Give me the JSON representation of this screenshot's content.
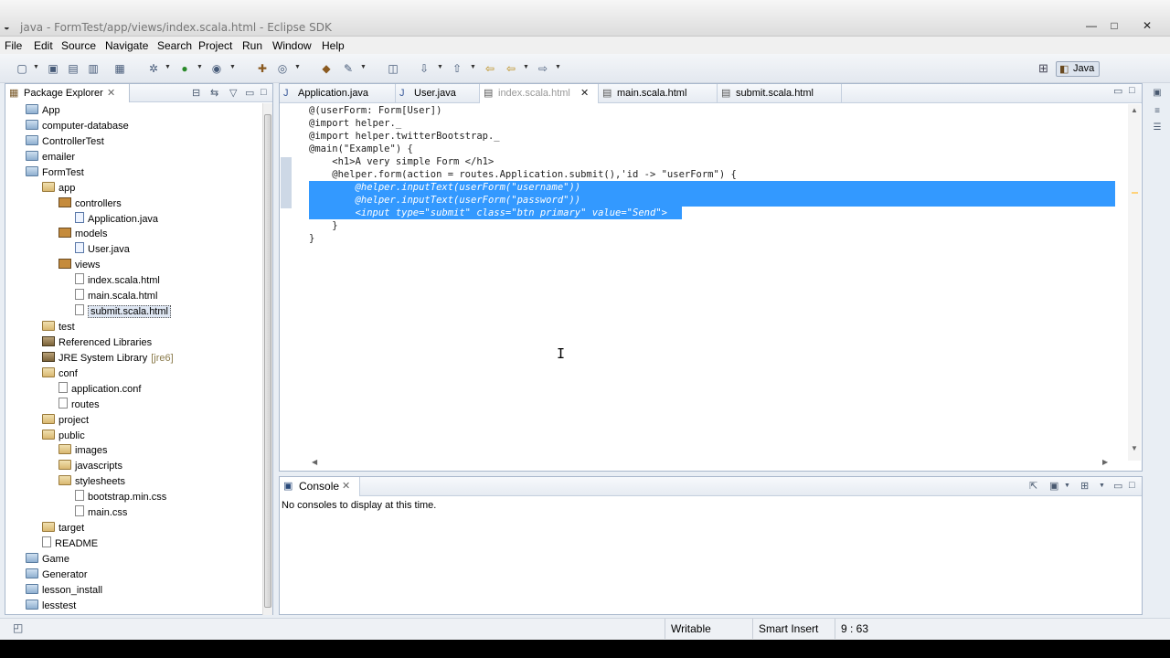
{
  "window": {
    "title": "java - FormTest/app/views/index.scala.html - Eclipse SDK",
    "minimize": "—",
    "maximize": "□",
    "close": "✕"
  },
  "menu": [
    "File",
    "Edit",
    "Source",
    "Navigate",
    "Search",
    "Project",
    "Run",
    "Window",
    "Help"
  ],
  "perspective": {
    "label": "Java"
  },
  "package_explorer": {
    "title": "Package Explorer",
    "items": [
      {
        "label": "App",
        "icon": "folder-icon",
        "depth": 0
      },
      {
        "label": "computer-database",
        "icon": "folder-icon",
        "depth": 0
      },
      {
        "label": "ControllerTest",
        "icon": "folder-icon",
        "depth": 0
      },
      {
        "label": "emailer",
        "icon": "folder-icon",
        "depth": 0
      },
      {
        "label": "FormTest",
        "icon": "folder-icon",
        "depth": 0
      },
      {
        "label": "app",
        "icon": "open-folder-icon",
        "depth": 1
      },
      {
        "label": "controllers",
        "icon": "package-icon",
        "depth": 2
      },
      {
        "label": "Application.java",
        "icon": "java-file-icon",
        "depth": 3
      },
      {
        "label": "models",
        "icon": "package-icon",
        "depth": 2
      },
      {
        "label": "User.java",
        "icon": "java-file-icon",
        "depth": 3
      },
      {
        "label": "views",
        "icon": "package-icon",
        "depth": 2
      },
      {
        "label": "index.scala.html",
        "icon": "file-icon",
        "depth": 3
      },
      {
        "label": "main.scala.html",
        "icon": "file-icon",
        "depth": 3
      },
      {
        "label": "submit.scala.html",
        "icon": "file-icon",
        "depth": 3,
        "selected": true
      },
      {
        "label": "test",
        "icon": "open-folder-icon",
        "depth": 1
      },
      {
        "label": "Referenced Libraries",
        "icon": "library-icon",
        "depth": 1
      },
      {
        "label": "JRE System Library",
        "suffix": "[jre6]",
        "icon": "library-icon",
        "depth": 1
      },
      {
        "label": "conf",
        "icon": "open-folder-icon",
        "depth": 1
      },
      {
        "label": "application.conf",
        "icon": "file-icon",
        "depth": 2
      },
      {
        "label": "routes",
        "icon": "file-icon",
        "depth": 2
      },
      {
        "label": "project",
        "icon": "open-folder-icon",
        "depth": 1
      },
      {
        "label": "public",
        "icon": "open-folder-icon",
        "depth": 1
      },
      {
        "label": "images",
        "icon": "open-folder-icon",
        "depth": 2
      },
      {
        "label": "javascripts",
        "icon": "open-folder-icon",
        "depth": 2
      },
      {
        "label": "stylesheets",
        "icon": "open-folder-icon",
        "depth": 2
      },
      {
        "label": "bootstrap.min.css",
        "icon": "file-icon",
        "depth": 3
      },
      {
        "label": "main.css",
        "icon": "file-icon",
        "depth": 3
      },
      {
        "label": "target",
        "icon": "open-folder-icon",
        "depth": 1
      },
      {
        "label": "README",
        "icon": "file-icon",
        "depth": 1
      },
      {
        "label": "Game",
        "icon": "folder-icon",
        "depth": 0
      },
      {
        "label": "Generator",
        "icon": "folder-icon",
        "depth": 0
      },
      {
        "label": "lesson_install",
        "icon": "folder-icon",
        "depth": 0
      },
      {
        "label": "lesstest",
        "icon": "folder-icon",
        "depth": 0
      }
    ]
  },
  "editor": {
    "tabs": [
      {
        "label": "Application.java",
        "active": false
      },
      {
        "label": "User.java",
        "active": false
      },
      {
        "label": "index.scala.html",
        "active": true
      },
      {
        "label": "main.scala.html",
        "active": false
      },
      {
        "label": "submit.scala.html",
        "active": false
      }
    ],
    "lines": [
      {
        "text": "@(userForm: Form[User])",
        "selected": false
      },
      {
        "text": "@import helper._",
        "selected": false
      },
      {
        "text": "@import helper.twitterBootstrap._",
        "selected": false
      },
      {
        "text": "@main(\"Example\") {",
        "selected": false
      },
      {
        "text": "    <h1>A very simple Form </h1>",
        "selected": false
      },
      {
        "text": "    @helper.form(action = routes.Application.submit(),'id -> \"userForm\") {",
        "selected": false
      },
      {
        "text": "        @helper.inputText(userForm(\"username\"))",
        "selected": true
      },
      {
        "text": "        @helper.inputText(userForm(\"password\"))",
        "selected": true
      },
      {
        "text": "        <input type=\"submit\" class=\"btn primary\" value=\"Send\">",
        "selected": true,
        "partial": true
      },
      {
        "text": "    }",
        "selected": false
      },
      {
        "text": "}",
        "selected": false
      }
    ]
  },
  "console": {
    "title": "Console",
    "message": "No consoles to display at this time."
  },
  "status": {
    "writable": "Writable",
    "insert_mode": "Smart Insert",
    "position": "9 : 63"
  }
}
